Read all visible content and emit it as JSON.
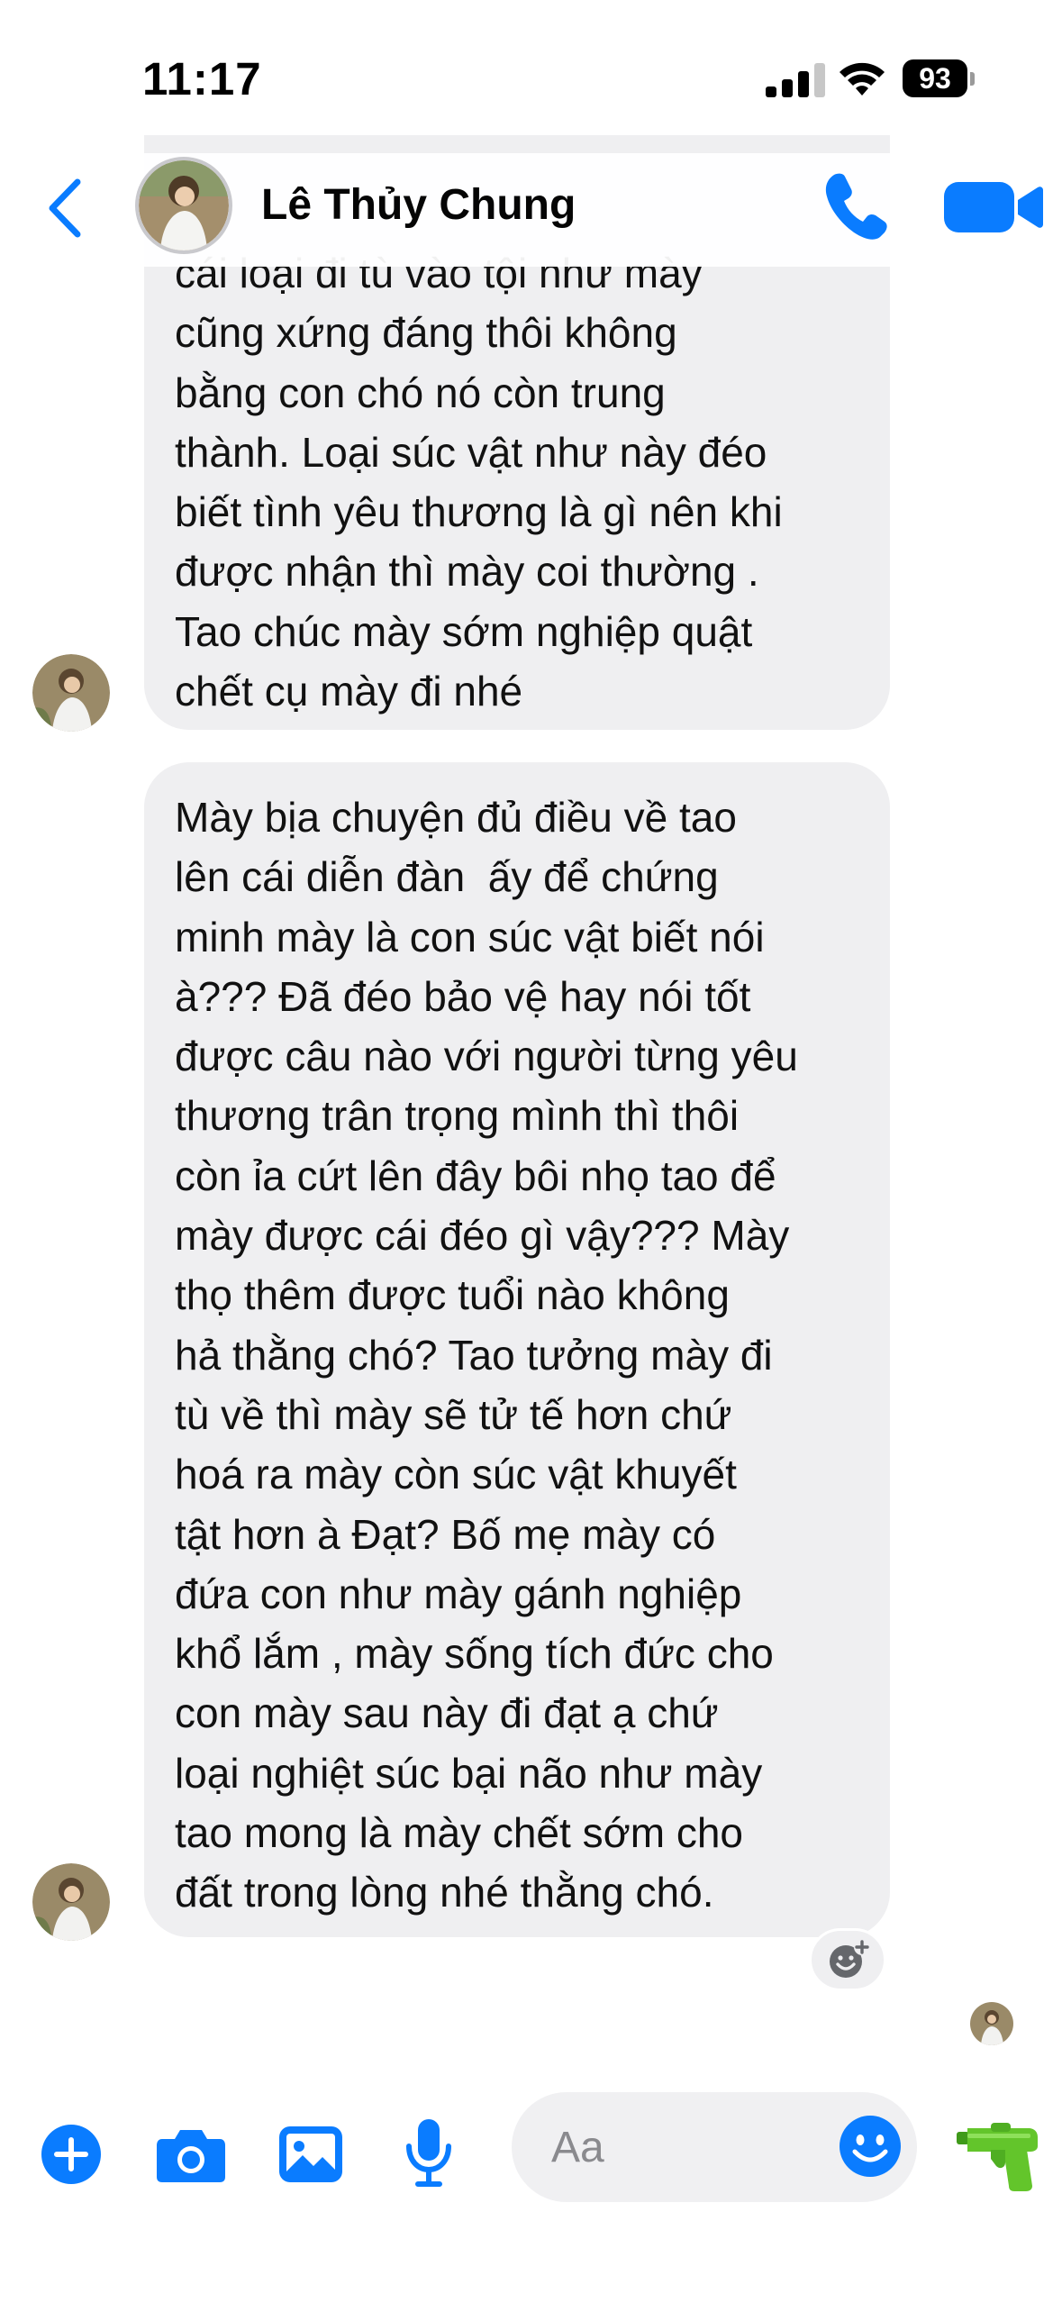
{
  "status_bar": {
    "time": "11:17",
    "battery": "93"
  },
  "header": {
    "contact_name": "Lê Thủy Chung"
  },
  "messages": [
    {
      "text": "cái loại đi tù vào tội như mày\ncũng xứng đáng thôi không\nbằng con chó nó còn trung\nthành. Loại súc vật như này đéo\nbiết tình yêu thương là gì nên khi\nđược nhận thì mày coi thường .\nTao chúc mày sớm nghiệp quật\nchết cụ mày đi nhé"
    },
    {
      "text": "Mày bịa chuyện đủ điều về tao\nlên cái diễn đàn  ấy để chứng\nminh mày là con súc vật biết nói\nà??? Đã đéo bảo vệ hay nói tốt\nđược câu nào với người từng yêu\nthương trân trọng mình thì thôi\ncòn ỉa cứt lên đây bôi nhọ tao để\nmày được cái đéo gì vậy??? Mày\nthọ thêm được tuổi nào không\nhả thằng chó? Tao tưởng mày đi\ntù về thì mày sẽ tử tế hơn chứ\nhoá ra mày còn súc vật khuyết\ntật hơn à Đạt? Bố mẹ mày có\nđứa con như mày gánh nghiệp\nkhổ lắm , mày sống tích đức cho\ncon mày sau này đi đạt ạ chứ\nloại nghiệt súc bại não như mày\ntao mong là mày chết sớm cho\nđất trong lòng nhé thằng chó."
    }
  ],
  "composer": {
    "placeholder": "Aa"
  },
  "colors": {
    "accent": "#0a7cff",
    "bubble": "#efeff1",
    "water_gun": "#63c52b"
  }
}
